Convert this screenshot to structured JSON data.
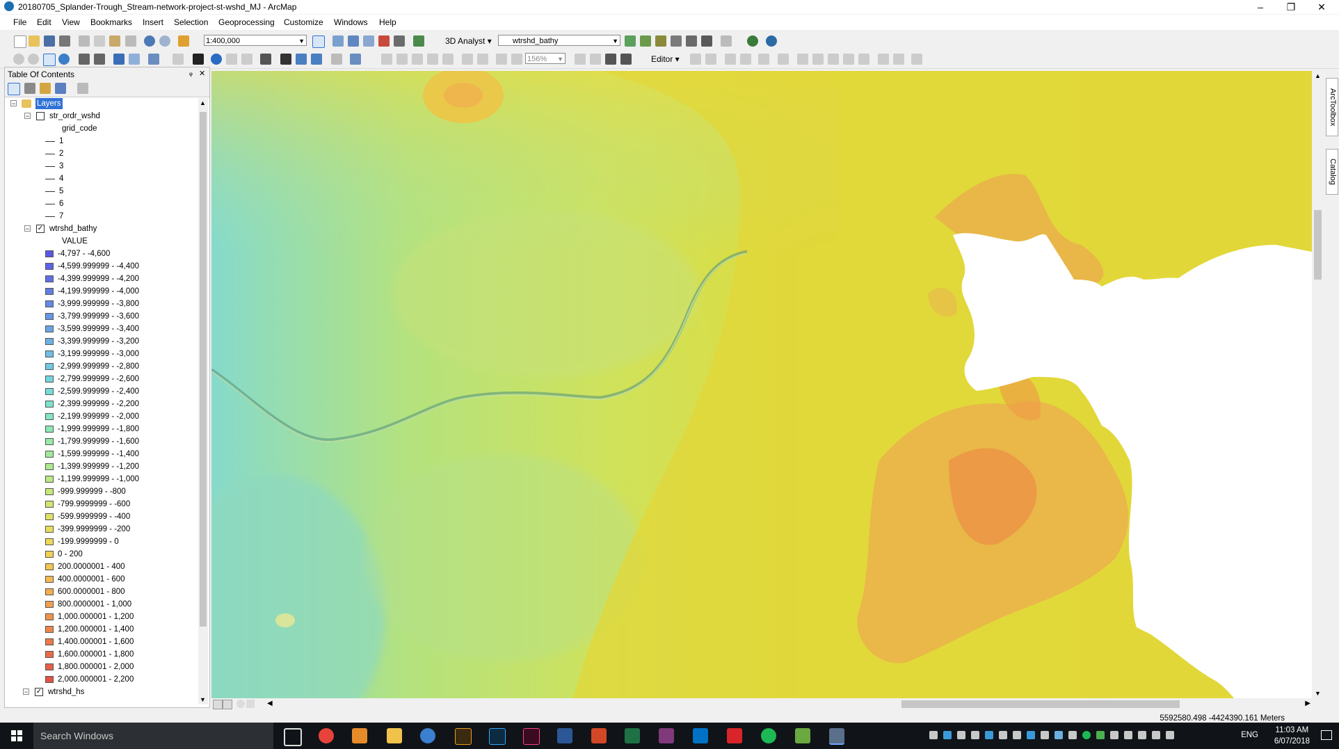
{
  "window": {
    "title": "20180705_Splander-Trough_Stream-network-project-st-wshd_MJ - ArcMap",
    "controls": [
      "–",
      "❐",
      "✕"
    ]
  },
  "menu": [
    "File",
    "Edit",
    "View",
    "Bookmarks",
    "Insert",
    "Selection",
    "Geoprocessing",
    "Customize",
    "Windows",
    "Help"
  ],
  "toolbar": {
    "scale": "1:400,000",
    "analyst": "3D Analyst ▾",
    "layer_combo": "wtrshd_bathy",
    "zoom_combo": "156%",
    "editor": "Editor ▾"
  },
  "toc": {
    "title": "Table Of Contents",
    "pin": "ᵩ",
    "close": "✕",
    "root": "Layers",
    "layer1": {
      "name": "str_ordr_wshd",
      "field": "grid_code",
      "classes": [
        "1",
        "2",
        "3",
        "4",
        "5",
        "6",
        "7"
      ]
    },
    "layer2": {
      "name": "wtrshd_bathy",
      "field": "VALUE",
      "classes": [
        {
          "label": "-4,797 - -4,600",
          "color": "#5b56e6"
        },
        {
          "label": "-4,599.999999 - -4,400",
          "color": "#5c63e6"
        },
        {
          "label": "-4,399.999999 - -4,200",
          "color": "#5e70e6"
        },
        {
          "label": "-4,199.999999 - -4,000",
          "color": "#607de6"
        },
        {
          "label": "-3,999.999999 - -3,800",
          "color": "#628ae6"
        },
        {
          "label": "-3,799.999999 - -3,600",
          "color": "#6597e6"
        },
        {
          "label": "-3,599.999999 - -3,400",
          "color": "#68a4e6"
        },
        {
          "label": "-3,399.999999 - -3,200",
          "color": "#6bb1e6"
        },
        {
          "label": "-3,199.999999 - -3,000",
          "color": "#6ebee6"
        },
        {
          "label": "-2,999.999999 - -2,800",
          "color": "#71cae4"
        },
        {
          "label": "-2,799.999999 - -2,600",
          "color": "#74d4de"
        },
        {
          "label": "-2,599.999999 - -2,400",
          "color": "#78dcd6"
        },
        {
          "label": "-2,399.999999 - -2,200",
          "color": "#7de2cc"
        },
        {
          "label": "-2,199.999999 - -2,000",
          "color": "#84e6c0"
        },
        {
          "label": "-1,999.999999 - -1,800",
          "color": "#8ce8b3"
        },
        {
          "label": "-1,799.999999 - -1,600",
          "color": "#96eaa6"
        },
        {
          "label": "-1,599.999999 - -1,400",
          "color": "#a2ea99"
        },
        {
          "label": "-1,399.999999 - -1,200",
          "color": "#aeea8d"
        },
        {
          "label": "-1,199.999999 - -1,000",
          "color": "#bbe982"
        },
        {
          "label": "-999.999999 - -800",
          "color": "#c8e878"
        },
        {
          "label": "-799.9999999 - -600",
          "color": "#d4e66e"
        },
        {
          "label": "-599.9999999 - -400",
          "color": "#dfe365"
        },
        {
          "label": "-399.9999999 - -200",
          "color": "#e8de5c"
        },
        {
          "label": "-199.9999999 - 0",
          "color": "#eed857"
        },
        {
          "label": "0 - 200",
          "color": "#f2d054"
        },
        {
          "label": "200.0000001 - 400",
          "color": "#f4c552"
        },
        {
          "label": "400.0000001 - 600",
          "color": "#f4b950"
        },
        {
          "label": "600.0000001 - 800",
          "color": "#f3ad4f"
        },
        {
          "label": "800.0000001 - 1,000",
          "color": "#f2a04d"
        },
        {
          "label": "1,000.000001 - 1,200",
          "color": "#f0934b"
        },
        {
          "label": "1,200.000001 - 1,400",
          "color": "#ee864a"
        },
        {
          "label": "1,400.000001 - 1,600",
          "color": "#ec7948"
        },
        {
          "label": "1,600.000001 - 1,800",
          "color": "#e96c47"
        },
        {
          "label": "1,800.000001 - 2,000",
          "color": "#e65f46"
        },
        {
          "label": "2,000.000001 - 2,200",
          "color": "#e35245"
        }
      ]
    },
    "layer3": {
      "name": "wtrshd_hs"
    }
  },
  "dock": {
    "tab1": "ArcToolbox",
    "tab2": "Catalog"
  },
  "status": {
    "coords": "5592580.498  -4424390.161 Meters"
  },
  "taskbar": {
    "search_placeholder": "Search Windows",
    "lang": "ENG",
    "time": "11:03 AM",
    "date": "6/07/2018"
  },
  "colors": {
    "map_land": "#e0d43a",
    "map_deep": "#7fd8cc",
    "map_mid": "#c9e070",
    "map_high": "#eea64e",
    "selected_layers_bg": "#3072d6"
  }
}
